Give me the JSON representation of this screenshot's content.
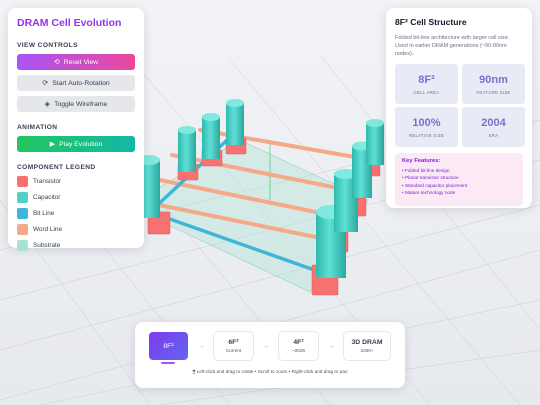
{
  "colors": {
    "accent": "#9333ea",
    "transistor": "#f87171",
    "capacitor": "#4fd1c5",
    "bit_line": "#3fb6d8",
    "word_line": "#f6a98a",
    "substrate": "#a7e3d0"
  },
  "controls": {
    "title": "DRAM Cell Evolution",
    "view_heading": "VIEW CONTROLS",
    "reset_label": "Reset View",
    "reset_icon": "reset-icon",
    "rotation_label": "Start Auto-Rotation",
    "rotation_icon": "rotate-icon",
    "wireframe_label": "Toggle Wireframe",
    "wireframe_icon": "cube-icon",
    "animation_heading": "ANIMATION",
    "play_label": "Play Evolution",
    "play_icon": "play-icon",
    "legend_heading": "COMPONENT LEGEND",
    "legend": [
      {
        "label": "Transistor",
        "color": "#f87171"
      },
      {
        "label": "Capacitor",
        "color": "#4fd1c5"
      },
      {
        "label": "Bit Line",
        "color": "#3fb6d8"
      },
      {
        "label": "Word Line",
        "color": "#f6a98a"
      },
      {
        "label": "Substrate",
        "color": "#a7e3d0"
      }
    ]
  },
  "info": {
    "title": "8F² Cell Structure",
    "description": "Folded bit-line architecture with larger cell size. Used in earlier DRAM generations (~90-80nm nodes).",
    "metrics": [
      {
        "value": "8F²",
        "label": "CELL AREA"
      },
      {
        "value": "90nm",
        "label": "FEATURE SIZE"
      },
      {
        "value": "100%",
        "label": "RELATIVE SIZE"
      },
      {
        "value": "2004",
        "label": "ERA"
      }
    ],
    "features_title": "Key Features:",
    "features": [
      "• Folded bit-line design",
      "• Planar transistor structure",
      "• Standard capacitor placement",
      "• Mature technology node"
    ]
  },
  "timeline": {
    "steps": [
      {
        "label": "8F²",
        "sub": ""
      },
      {
        "label": "6F²",
        "sub": "Current"
      },
      {
        "label": "4F²",
        "sub": "~2028"
      },
      {
        "label": "3D DRAM",
        "sub": "2030+"
      }
    ],
    "arrow": "→",
    "hint": "🖱 Left-click and drag to rotate • Scroll to zoom • Right-click and drag to pan"
  }
}
